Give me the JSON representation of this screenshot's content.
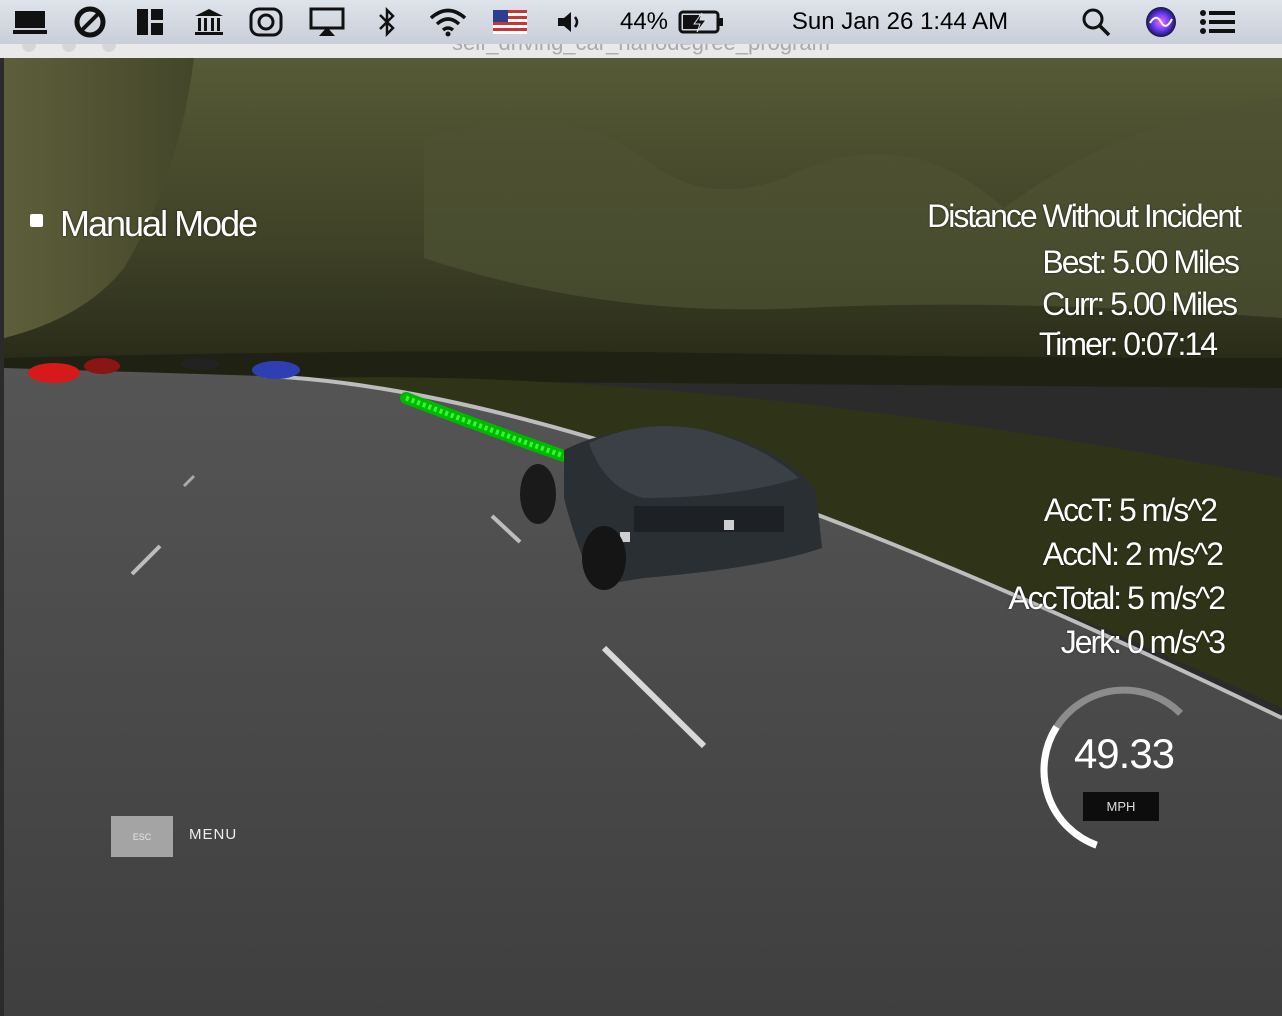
{
  "menubar": {
    "battery_percent": "44%",
    "clock": "Sun Jan 26  1:44 AM",
    "icons": [
      "display-icon",
      "creative-cloud-icon",
      "grid-app-icon",
      "bank-icon",
      "copyright-app-icon",
      "airplay-icon",
      "bluetooth-icon",
      "wifi-icon",
      "us-flag-icon",
      "volume-icon",
      "battery-charging-icon",
      "spotlight-search-icon",
      "siri-icon",
      "notification-center-icon"
    ]
  },
  "window": {
    "title": "self_driving_car_nanodegree_program"
  },
  "hud": {
    "mode_label": "Manual Mode",
    "distance_title": "Distance Without Incident",
    "best": "Best: 5.00 Miles",
    "curr": "Curr: 5.00 Miles",
    "timer": "Timer: 0:07:14",
    "acc_t": "AccT: 5 m/s^2",
    "acc_n": "AccN: 2 m/s^2",
    "acc_total": "AccTotal: 5 m/s^2",
    "jerk": "Jerk: 0 m/s^3",
    "speed": "49.33",
    "speed_unit": "MPH",
    "speedometer_fraction": 0.5,
    "esc_key": "ESC",
    "menu_label": "MENU"
  },
  "colors": {
    "path": "#00e000",
    "sky_terrain": "#4a4c2c",
    "road": "#4a4a4a"
  }
}
